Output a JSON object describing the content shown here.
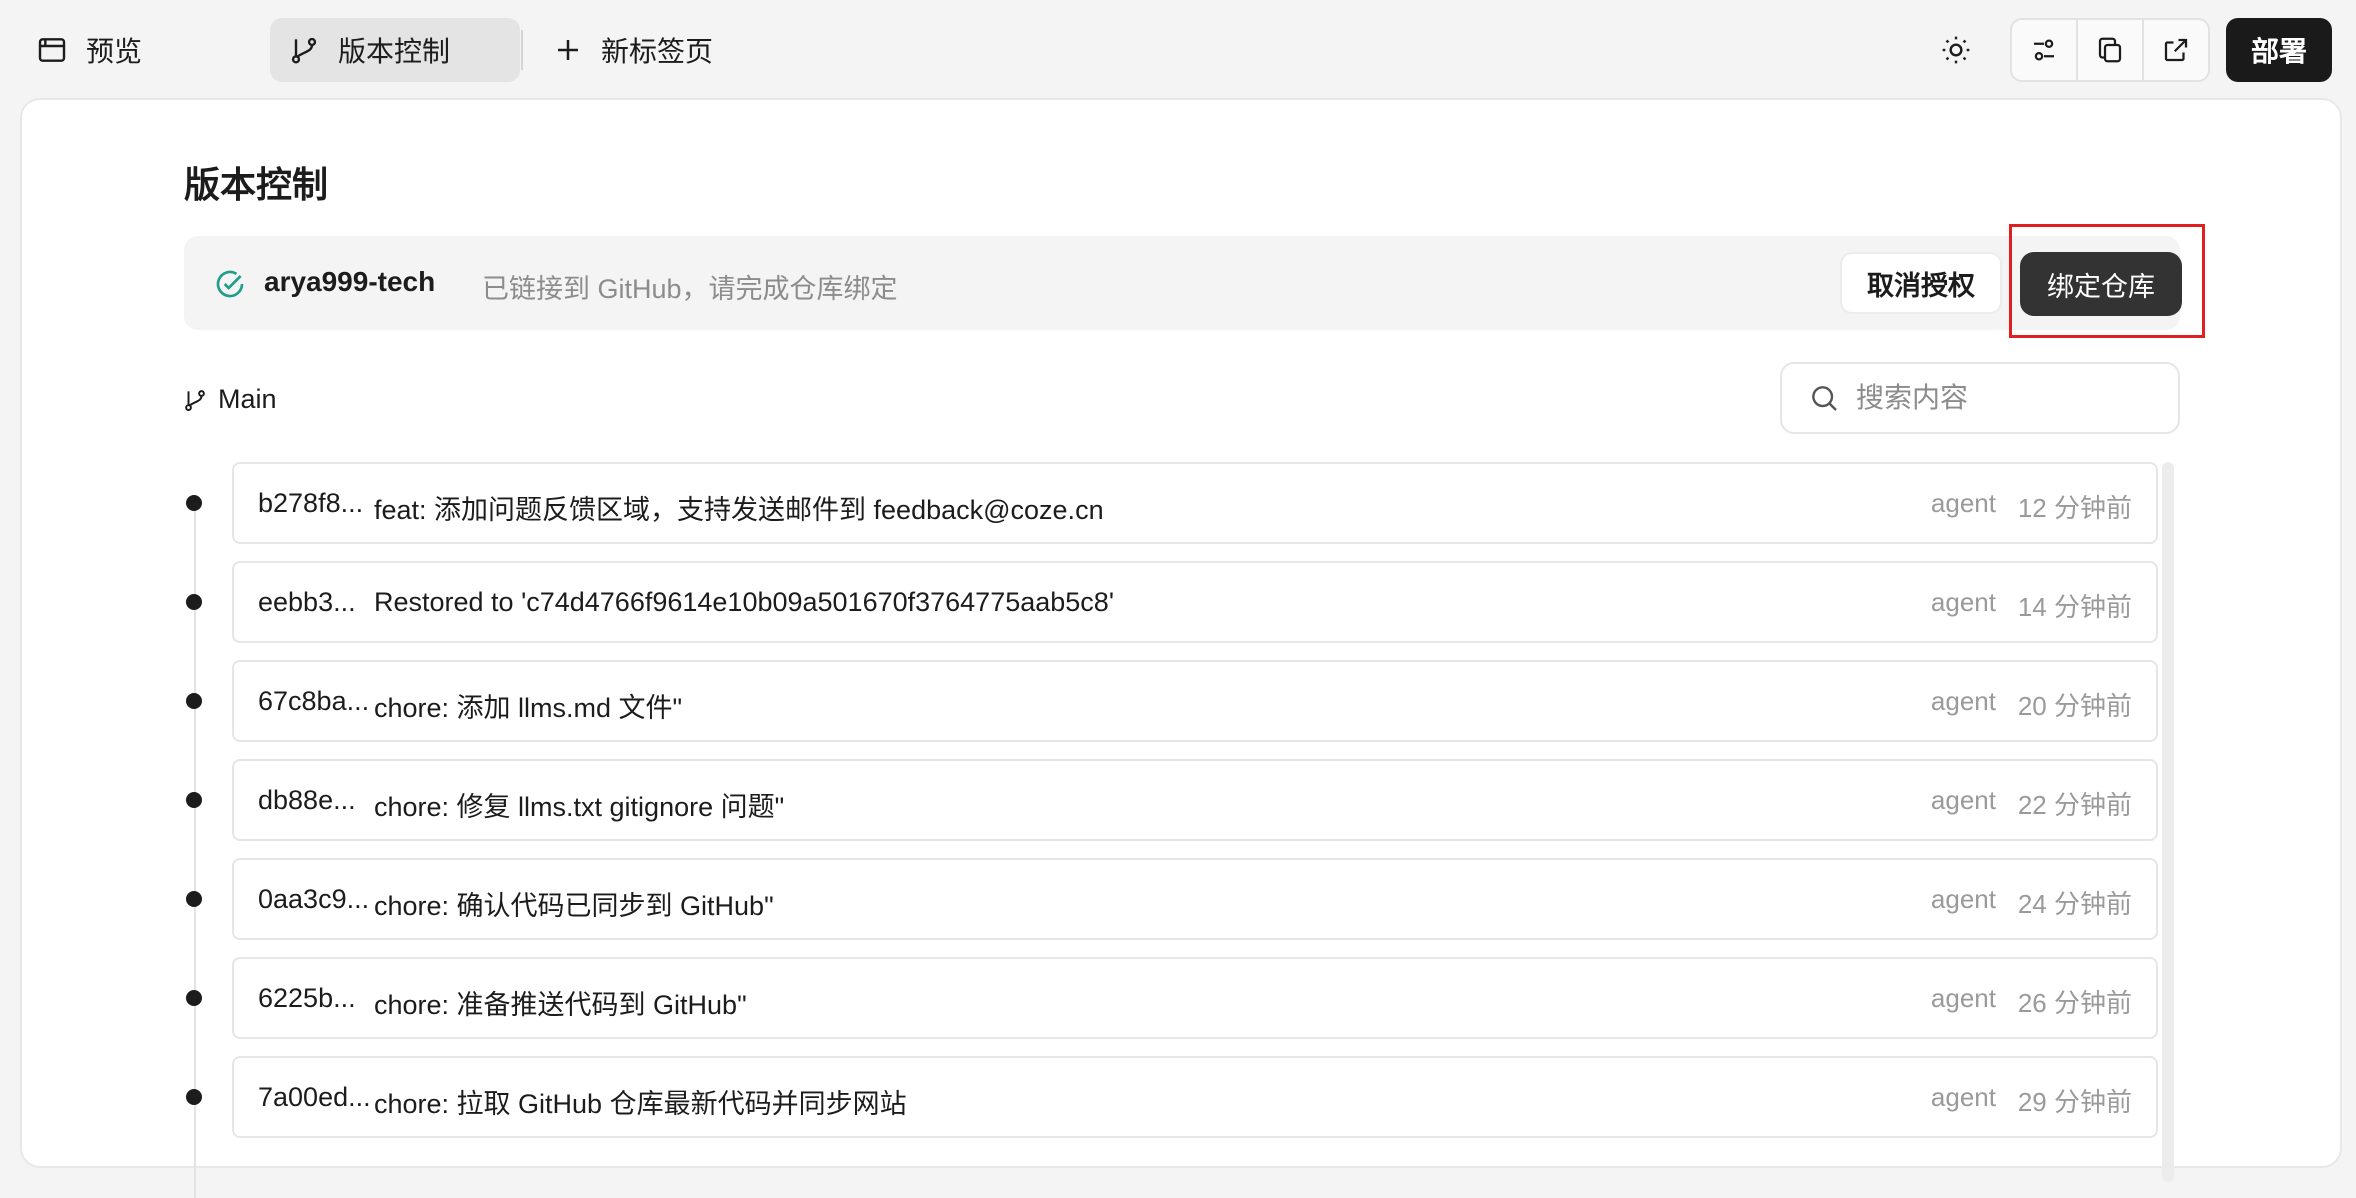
{
  "topbar": {
    "tabs": [
      {
        "label": "预览",
        "icon": "browser-window-icon"
      },
      {
        "label": "版本控制",
        "icon": "git-branch-icon"
      },
      {
        "label": "新标签页",
        "icon": "plus-icon"
      }
    ],
    "deploy_label": "部署",
    "icons": [
      "sun-icon",
      "sliders-icon",
      "copy-icon",
      "external-link-icon"
    ]
  },
  "main": {
    "title": "版本控制",
    "account": {
      "username": "arya999-tech",
      "status": "已链接到 GitHub，请完成仓库绑定",
      "revoke_label": "取消授权",
      "bind_label": "绑定仓库"
    },
    "branch": "Main",
    "search": {
      "placeholder": "搜索内容",
      "value": ""
    },
    "commits": [
      {
        "hash": "b278f8...",
        "message": "feat: 添加问题反馈区域，支持发送邮件到 feedback@coze.cn",
        "author": "agent",
        "time": "12 分钟前"
      },
      {
        "hash": "eebb3...",
        "message": "Restored to 'c74d4766f9614e10b09a501670f3764775aab5c8'",
        "author": "agent",
        "time": "14 分钟前"
      },
      {
        "hash": "67c8ba...",
        "message": "chore: 添加 llms.md 文件\"",
        "author": "agent",
        "time": "20 分钟前"
      },
      {
        "hash": "db88e...",
        "message": "chore: 修复 llms.txt gitignore 问题\"",
        "author": "agent",
        "time": "22 分钟前"
      },
      {
        "hash": "0aa3c9...",
        "message": "chore: 确认代码已同步到 GitHub\"",
        "author": "agent",
        "time": "24 分钟前"
      },
      {
        "hash": "6225b...",
        "message": "chore: 准备推送代码到 GitHub\"",
        "author": "agent",
        "time": "26 分钟前"
      },
      {
        "hash": "7a00ed...",
        "message": "chore: 拉取 GitHub 仓库最新代码并同步网站",
        "author": "agent",
        "time": "29 分钟前"
      }
    ]
  },
  "colors": {
    "accent_dark": "#1a1a1a",
    "check_green": "#1f9e8a",
    "highlight_red": "#e02020"
  }
}
